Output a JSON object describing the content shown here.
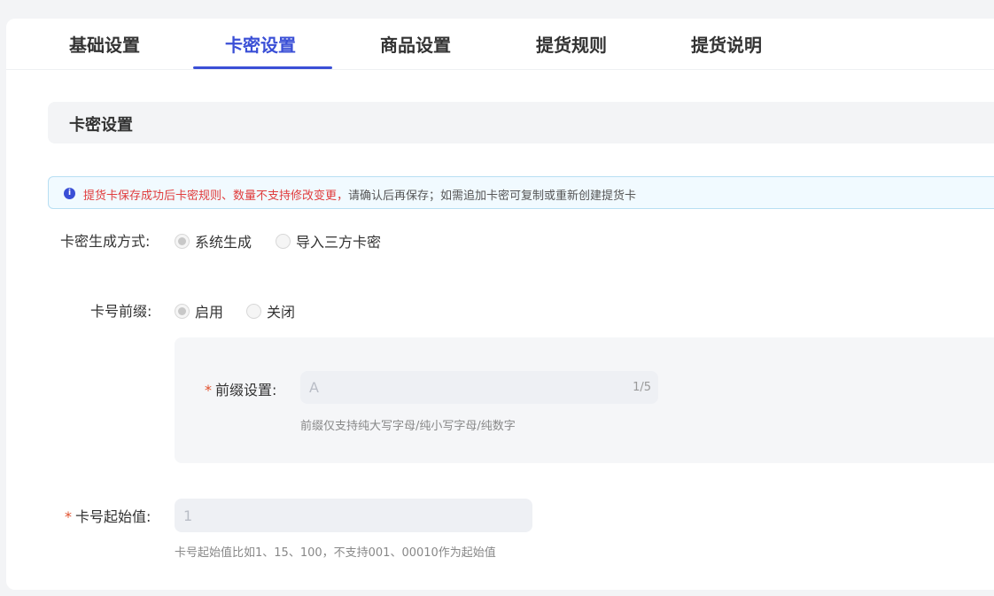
{
  "tabs": [
    {
      "label": "基础设置"
    },
    {
      "label": "卡密设置"
    },
    {
      "label": "商品设置"
    },
    {
      "label": "提货规则"
    },
    {
      "label": "提货说明"
    }
  ],
  "section": {
    "title": "卡密设置"
  },
  "notice": {
    "icon": "info-icon",
    "warning": "提货卡保存成功后卡密规则、数量不支持修改变更，",
    "detail": "请确认后再保存；如需追加卡密可复制或重新创建提货卡"
  },
  "generation": {
    "label": "卡密生成方式:",
    "options": [
      {
        "label": "系统生成",
        "checked": true
      },
      {
        "label": "导入三方卡密",
        "checked": false
      }
    ]
  },
  "prefix": {
    "label": "卡号前缀:",
    "options": [
      {
        "label": "启用",
        "checked": true
      },
      {
        "label": "关闭",
        "checked": false
      }
    ],
    "setting": {
      "required_mark": "*",
      "label": "前缀设置:",
      "value": "A",
      "counter": "1/5",
      "hint": "前缀仅支持纯大写字母/纯小写字母/纯数字"
    }
  },
  "start_value": {
    "required_mark": "*",
    "label": "卡号起始值:",
    "placeholder": "1",
    "hint": "卡号起始值比如1、15、100，不支持001、00010作为起始值"
  },
  "colors": {
    "accent": "#3a4fd6",
    "warning": "#e03c3c",
    "required": "#e0502d"
  }
}
